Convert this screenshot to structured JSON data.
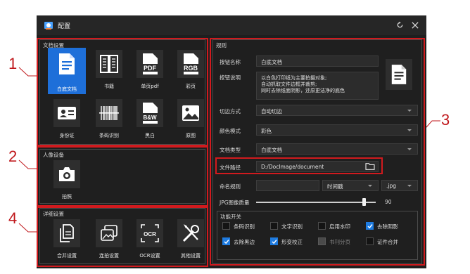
{
  "annotations": [
    "1",
    "2",
    "3",
    "4"
  ],
  "window": {
    "title": "配置",
    "refresh_icon": "refresh-icon",
    "close_icon": "close-icon"
  },
  "doc_settings": {
    "title": "文档设置",
    "tiles": [
      {
        "label": "白底文档",
        "icon": "document-icon",
        "active": true
      },
      {
        "label": "书籍",
        "icon": "book-icon"
      },
      {
        "label": "单页pdf",
        "icon": "pdf-icon",
        "badge": "PDF"
      },
      {
        "label": "彩页",
        "icon": "rgb-icon",
        "badge": "RGB"
      },
      {
        "label": "身份证",
        "icon": "id-card-icon"
      },
      {
        "label": "条码识别",
        "icon": "barcode-icon"
      },
      {
        "label": "黑白",
        "icon": "bw-icon",
        "badge": "B&W"
      },
      {
        "label": "原图",
        "icon": "image-icon"
      }
    ]
  },
  "portrait_settings": {
    "title": "人像设备",
    "tiles": [
      {
        "label": "拍照",
        "icon": "camera-icon"
      }
    ]
  },
  "detail_settings": {
    "title": "详细设置",
    "tiles": [
      {
        "label": "合并设置",
        "icon": "merge-icon"
      },
      {
        "label": "连拍设置",
        "icon": "burst-icon"
      },
      {
        "label": "OCR设置",
        "icon": "ocr-icon",
        "badge": "OCR"
      },
      {
        "label": "其他设置",
        "icon": "tools-icon"
      }
    ]
  },
  "rules": {
    "title": "规则",
    "button_name_label": "按钮名称",
    "button_name_value": "白底文档",
    "button_desc_label": "按钮说明",
    "button_desc_lines": [
      "以白色打印纸为主要拍摄对象;",
      "自动抓取文件边框并裁剪;",
      "同时去除纸面阴影，还原更洁净的底色"
    ],
    "crop_label": "切边方式",
    "crop_value": "自动切边",
    "color_label": "颜色模式",
    "color_value": "彩色",
    "doctype_label": "文档类型",
    "doctype_value": "白底文档",
    "path_label": "文件路径",
    "path_value": "D:/DocImage/document",
    "naming_label": "命名规则",
    "naming_prefix": "",
    "naming_mode": "时间戳",
    "naming_ext": ".jpg",
    "jpg_label": "JPG图像质量",
    "jpg_quality": 90,
    "switches_title": "功能开关",
    "switches": [
      {
        "label": "条码识别",
        "checked": false,
        "disabled": false
      },
      {
        "label": "文字识别",
        "checked": false,
        "disabled": false
      },
      {
        "label": "启用水印",
        "checked": false,
        "disabled": false
      },
      {
        "label": "去除阴影",
        "checked": true,
        "disabled": false
      },
      {
        "label": "去除黑边",
        "checked": true,
        "disabled": false
      },
      {
        "label": "形变校正",
        "checked": true,
        "disabled": false
      },
      {
        "label": "书刊分页",
        "checked": false,
        "disabled": true
      },
      {
        "label": "证件合并",
        "checked": false,
        "disabled": false
      }
    ]
  },
  "colors": {
    "accent": "#1e6fd9",
    "highlight": "#d11a1e",
    "panel": "#1f1f1f"
  }
}
